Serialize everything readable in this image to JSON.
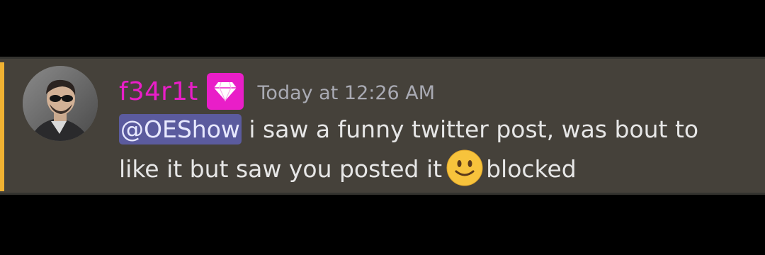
{
  "message": {
    "author": {
      "username": "f34r1t",
      "username_color": "#e91ec8",
      "avatar_icon": "user-avatar",
      "role_badge_icon": "diamond-icon"
    },
    "timestamp": "Today at 12:26 AM",
    "mention": "@OEShow",
    "text_after_mention": " i saw a funny twitter post, was bout to like it but saw you posted it",
    "emoji": "slightly-smiling-face-emoji",
    "text_after_emoji": "blocked",
    "highlight_color": "#f0b232"
  }
}
